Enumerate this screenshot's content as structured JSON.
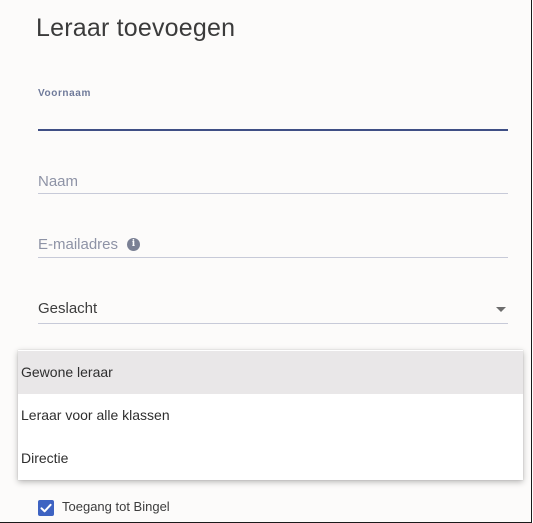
{
  "dialog": {
    "title": "Leraar toevoegen"
  },
  "form": {
    "first_name": {
      "label": "Voornaam",
      "value": ""
    },
    "last_name": {
      "placeholder": "Naam",
      "value": ""
    },
    "email": {
      "placeholder": "E-mailadres",
      "info_icon": "info-icon"
    },
    "gender": {
      "placeholder": "Geslacht",
      "icon": "chevron-down-icon"
    }
  },
  "role_menu": {
    "options": [
      {
        "label": "Gewone leraar",
        "highlighted": true
      },
      {
        "label": "Leraar voor alle klassen",
        "highlighted": false
      },
      {
        "label": "Directie",
        "highlighted": false
      }
    ]
  },
  "bingel_access": {
    "label": "Toegang tot Bingel",
    "checked": true
  },
  "colors": {
    "accent": "#3f4f85",
    "checkbox": "#3e63c2",
    "menu_highlight": "#e9e7e8"
  }
}
